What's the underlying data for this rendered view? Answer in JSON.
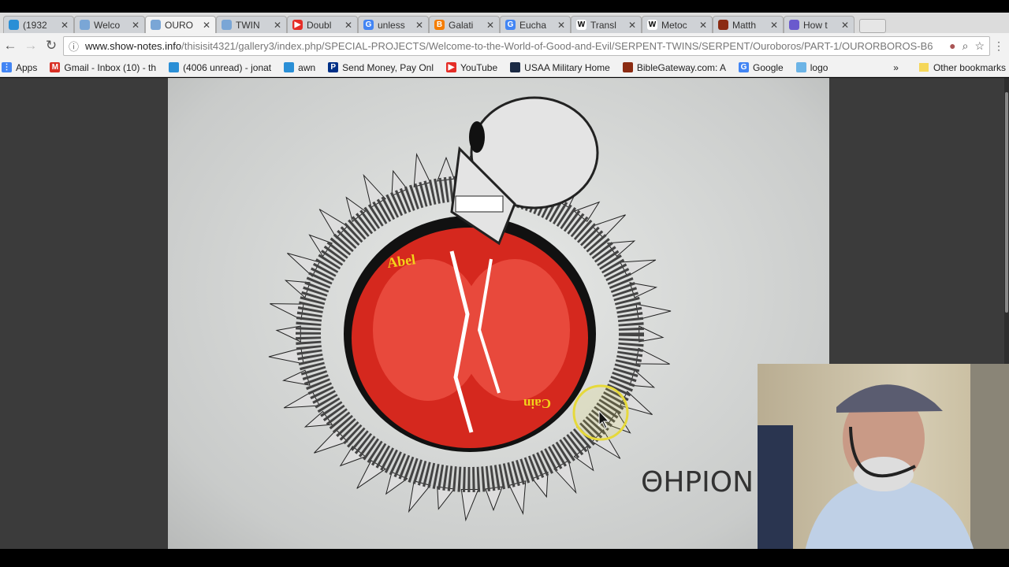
{
  "tabs": [
    {
      "title": "(1932",
      "icon": "att-icon",
      "color": "#2a8fd6"
    },
    {
      "title": "Welco",
      "icon": "gallery-icon",
      "color": "#7aa6d6"
    },
    {
      "title": "OURO",
      "icon": "gallery-icon",
      "color": "#7aa6d6",
      "active": true
    },
    {
      "title": "TWIN",
      "icon": "gallery-icon",
      "color": "#7aa6d6"
    },
    {
      "title": "Doubl",
      "icon": "youtube-icon",
      "color": "#e52d27"
    },
    {
      "title": "unless",
      "icon": "google-icon",
      "color": "#4285f4"
    },
    {
      "title": "Galati",
      "icon": "blogger-icon",
      "color": "#f57d00"
    },
    {
      "title": "Eucha",
      "icon": "google-icon",
      "color": "#4285f4"
    },
    {
      "title": "Transl",
      "icon": "wikipedia-icon",
      "color": "#ffffff"
    },
    {
      "title": "Metoc",
      "icon": "wikipedia-icon",
      "color": "#ffffff"
    },
    {
      "title": "Matth",
      "icon": "biblegateway-icon",
      "color": "#8b2b12"
    },
    {
      "title": "How t",
      "icon": "swirl-icon",
      "color": "#6a5acd"
    }
  ],
  "address": {
    "host": "www.show-notes.info",
    "path": "/thisisit4321/gallery3/index.php/SPECIAL-PROJECTS/Welcome-to-the-World-of-Good-and-Evil/SERPENT-TWINS/SERPENT/Ouroboros/PART-1/OURORBOROS-B6"
  },
  "bookmarks": [
    {
      "label": "Apps",
      "icon": "apps-grid-icon",
      "color": "#4285f4"
    },
    {
      "label": "Gmail - Inbox (10) - th",
      "icon": "gmail-icon",
      "color": "#d93025"
    },
    {
      "label": "(4006 unread) - jonat",
      "icon": "att-icon",
      "color": "#2a8fd6"
    },
    {
      "label": "awn",
      "icon": "awn-icon",
      "color": "#2a8fd6"
    },
    {
      "label": "Send Money, Pay Onl",
      "icon": "paypal-icon",
      "color": "#003087"
    },
    {
      "label": "YouTube",
      "icon": "youtube-icon",
      "color": "#e52d27"
    },
    {
      "label": "USAA Military Home",
      "icon": "usaa-icon",
      "color": "#1b2a44"
    },
    {
      "label": "BibleGateway.com: A",
      "icon": "biblegateway-icon",
      "color": "#8b2b12"
    },
    {
      "label": "Google",
      "icon": "google-icon",
      "color": "#4285f4"
    },
    {
      "label": "logo",
      "icon": "logo-icon",
      "color": "#6cb4e6"
    }
  ],
  "other_bookmarks": "Other bookmarks",
  "artwork": {
    "label_left": "Abel",
    "label_right": "Cain",
    "caption": "ΘΗΡΙΟΝ"
  }
}
